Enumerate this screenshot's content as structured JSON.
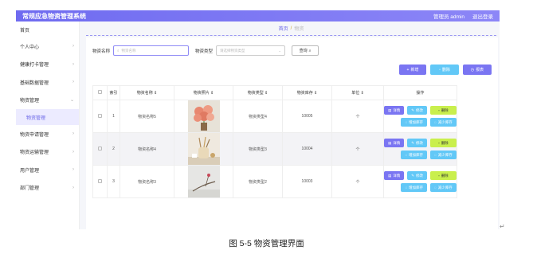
{
  "topbar": {
    "title": "常规应急物资管理系统",
    "user": "管理员 admin",
    "logout": "退出登录"
  },
  "sidebar": {
    "items": [
      {
        "label": "首页",
        "chev": ""
      },
      {
        "label": "个人中心",
        "chev": "›"
      },
      {
        "label": "健康打卡管理",
        "chev": "›"
      },
      {
        "label": "基础数据管理",
        "chev": "›"
      },
      {
        "label": "物资管理",
        "chev": "⌄"
      },
      {
        "label": "物资管理",
        "chev": ""
      },
      {
        "label": "物资申请管理",
        "chev": "›"
      },
      {
        "label": "物资运输管理",
        "chev": "›"
      },
      {
        "label": "用户管理",
        "chev": "›"
      },
      {
        "label": "部门管理",
        "chev": "›"
      }
    ]
  },
  "breadcrumb": {
    "home": "首页",
    "sep": "/",
    "current": "物资"
  },
  "search": {
    "name_label": "物资名称",
    "name_placeholder": "物资名称",
    "type_label": "物资类型",
    "type_placeholder": "请选择物资类型",
    "query_button": "查询"
  },
  "actions": {
    "add": "新增",
    "delete": "删除",
    "report": "报表"
  },
  "table": {
    "headers": [
      "索引",
      "物资名称 ⇕",
      "物资照片 ⇕",
      "物资类型 ⇕",
      "物资库存 ⇕",
      "单位 ⇕",
      "操作"
    ],
    "rows": [
      {
        "index": "1",
        "name": "物资名称5",
        "type": "物资类型4",
        "stock": "10005",
        "unit": "个"
      },
      {
        "index": "2",
        "name": "物资名称4",
        "type": "物资类型3",
        "stock": "10004",
        "unit": "个"
      },
      {
        "index": "3",
        "name": "物资名称3",
        "type": "物资类型2",
        "stock": "10003",
        "unit": "个"
      }
    ],
    "ops": {
      "detail": "详情",
      "edit": "修改",
      "delete": "删除",
      "add_stock": "增加库存",
      "reduce_stock": "减少库存"
    }
  },
  "caption": "图 5-5 物资管理界面",
  "colors": {
    "brand": "#7a75f2",
    "cyan": "#62c8f7",
    "lime": "#c9ef4d"
  }
}
